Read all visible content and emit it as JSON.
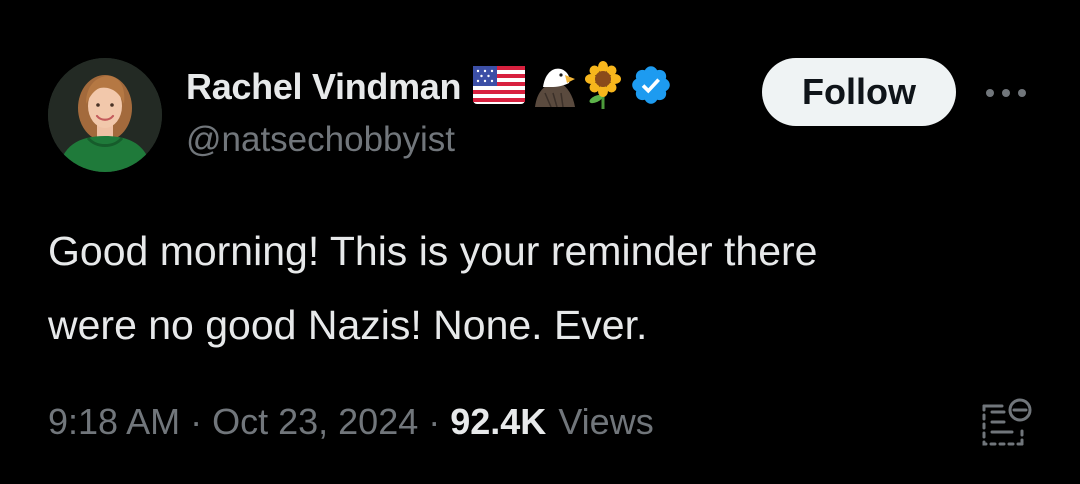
{
  "author": {
    "display_name": "Rachel Vindman",
    "handle": "@natsechobbyist",
    "name_emojis": [
      "us-flag-icon",
      "eagle-icon",
      "sunflower-icon"
    ],
    "verified": true
  },
  "follow_button": {
    "label": "Follow"
  },
  "more_menu": {
    "label": "···"
  },
  "tweet": {
    "text_lines": [
      "Good morning! This is your reminder there",
      "were no good Nazis! None. Ever."
    ]
  },
  "meta": {
    "time": "9:18 AM",
    "separator": "·",
    "date": "Oct 23, 2024",
    "views_count": "92.4K",
    "views_label": "Views"
  },
  "colors": {
    "background": "#000000",
    "primary_text": "#e7e9ea",
    "secondary_text": "#71767b",
    "verified_blue": "#1d9bf0",
    "follow_bg": "#eff3f4"
  }
}
